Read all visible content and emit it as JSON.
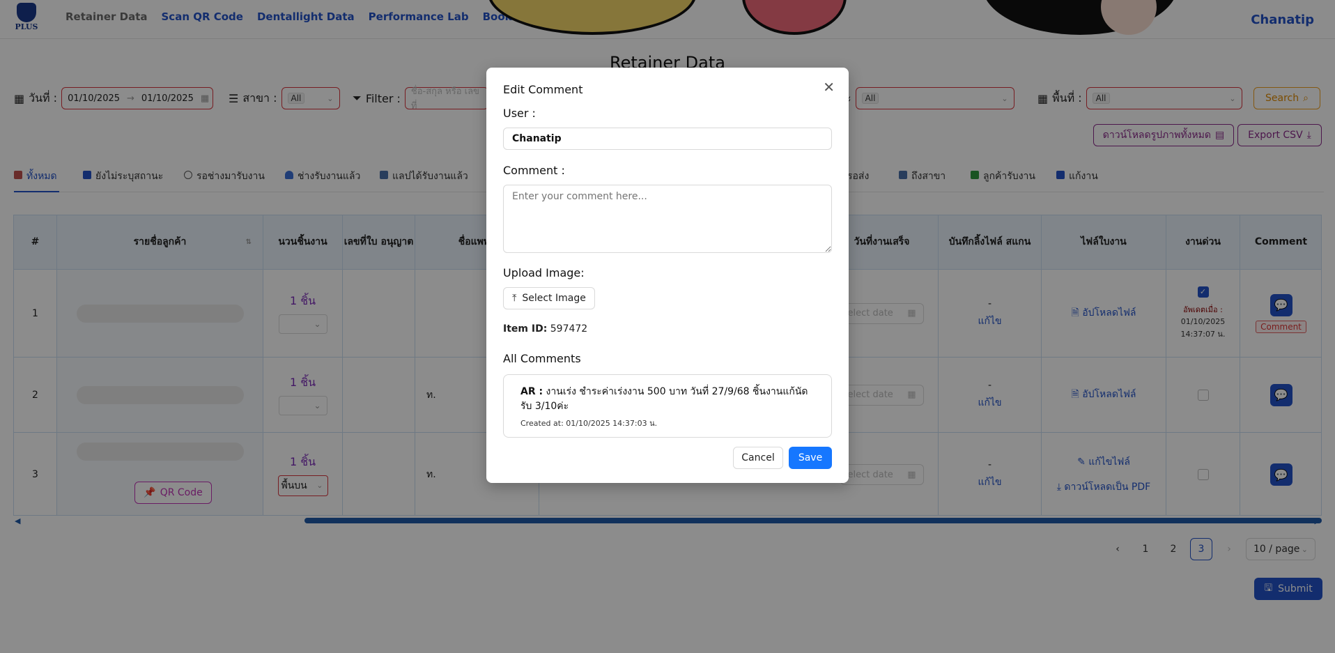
{
  "nav": {
    "logo_text": "PLUS",
    "items": [
      "Retainer Data",
      "Scan QR Code",
      "Dentallight Data",
      "Performance Lab",
      "Booking"
    ],
    "user": "Chanatip"
  },
  "page": {
    "title": "Retainer Data"
  },
  "filters": {
    "date_label": "วันที่ :",
    "date_from": "01/10/2025",
    "date_to": "01/10/2025",
    "branch_label": "สาขา :",
    "branch_tag": "All",
    "filter_label": "Filter :",
    "filter_placeholder": "ชื่อ-สกุล หรือ เลขที่",
    "status_label": "ะ",
    "status_tag": "All",
    "area_label": "พื้นที่ :",
    "area_tag": "All",
    "search_label": "Search"
  },
  "actions": {
    "download_all": "ดาวน์โหลดรูปภาพทั้งหมด",
    "export_csv": "Export CSV"
  },
  "tabs": [
    {
      "label": "ทั้งหมด",
      "color": "#c0504d"
    },
    {
      "label": "ยังไม่ระบุสถานะ",
      "color": "#2453c8"
    },
    {
      "label": "รอช่างมารับงาน",
      "color": "#555555"
    },
    {
      "label": "ช่างรับงานแล้ว",
      "color": "#3b6fd8"
    },
    {
      "label": "แลปได้รับงานแล้ว",
      "color": "#4a6fa8"
    },
    {
      "label": "รอส่ง",
      "color": "#4a6fa8"
    },
    {
      "label": "ถึงสาขา",
      "color": "#4a6fa8"
    },
    {
      "label": "ลูกค้ารับงาน",
      "color": "#2e9a3e"
    },
    {
      "label": "แก้งาน",
      "color": "#2453c8"
    }
  ],
  "table": {
    "headers": {
      "num": "#",
      "customer": "รายชื่อลูกค้า",
      "pieces": "นวนชิ้นงาน",
      "license": "เลขที่ใบ อนุญาต",
      "doctor": "ชื่อแพทย์",
      "finish_date": "วันที่งานเสร็จ",
      "scan_file": "บันทึกลิ้งไฟล์ สแกน",
      "work_file": "ไฟล์ใบงาน",
      "urgent": "งานด่วน",
      "comment": "Comment"
    },
    "rows": [
      {
        "num": "1",
        "pieces": "1 ชิ้น",
        "doctor": "",
        "scan": "-",
        "edit": "แก้ไข",
        "file": "อัปโหลดไฟล์",
        "date_ph": "elect date",
        "urgent_label": "อัพเดตเมื่อ :",
        "urgent_date": "01/10/2025",
        "urgent_time": "14:37:07 น.",
        "comment_tag": "Comment"
      },
      {
        "num": "2",
        "pieces": "1 ชิ้น",
        "doctor": "ท.",
        "scan": "-",
        "edit": "แก้ไข",
        "file": "อัปโหลดไฟล์",
        "date_ph": "elect date"
      },
      {
        "num": "3",
        "pieces": "1 ชิ้น",
        "doctor": "ท.",
        "select_val": "พื้นบน",
        "scan": "-",
        "edit": "แก้ไข",
        "edit_file": "แก้ไขไฟล์",
        "download_pdf": "ดาวน์โหลดเป็น PDF",
        "date_ph": "elect date",
        "qr": "QR Code"
      }
    ]
  },
  "pagination": {
    "pages": [
      "1",
      "2",
      "3"
    ],
    "page_size": "10 / page"
  },
  "submit": "Submit",
  "modal": {
    "title": "Edit Comment",
    "user_label": "User :",
    "user_value": "Chanatip",
    "comment_label": "Comment :",
    "comment_placeholder": "Enter your comment here...",
    "upload_label": "Upload Image:",
    "select_image": "Select Image",
    "item_id_label": "Item ID:",
    "item_id_value": "597472",
    "all_comments": "All Comments",
    "comments": [
      {
        "author": "AR :",
        "text": "งานเร่ง ชำระค่าเร่งงาน 500 บาท วันที่ 27/9/68 ชิ้นงานแก้นัดรับ 3/10ค่ะ",
        "created": "Created at: 01/10/2025 14:37:03 น."
      }
    ],
    "cancel": "Cancel",
    "save": "Save"
  }
}
